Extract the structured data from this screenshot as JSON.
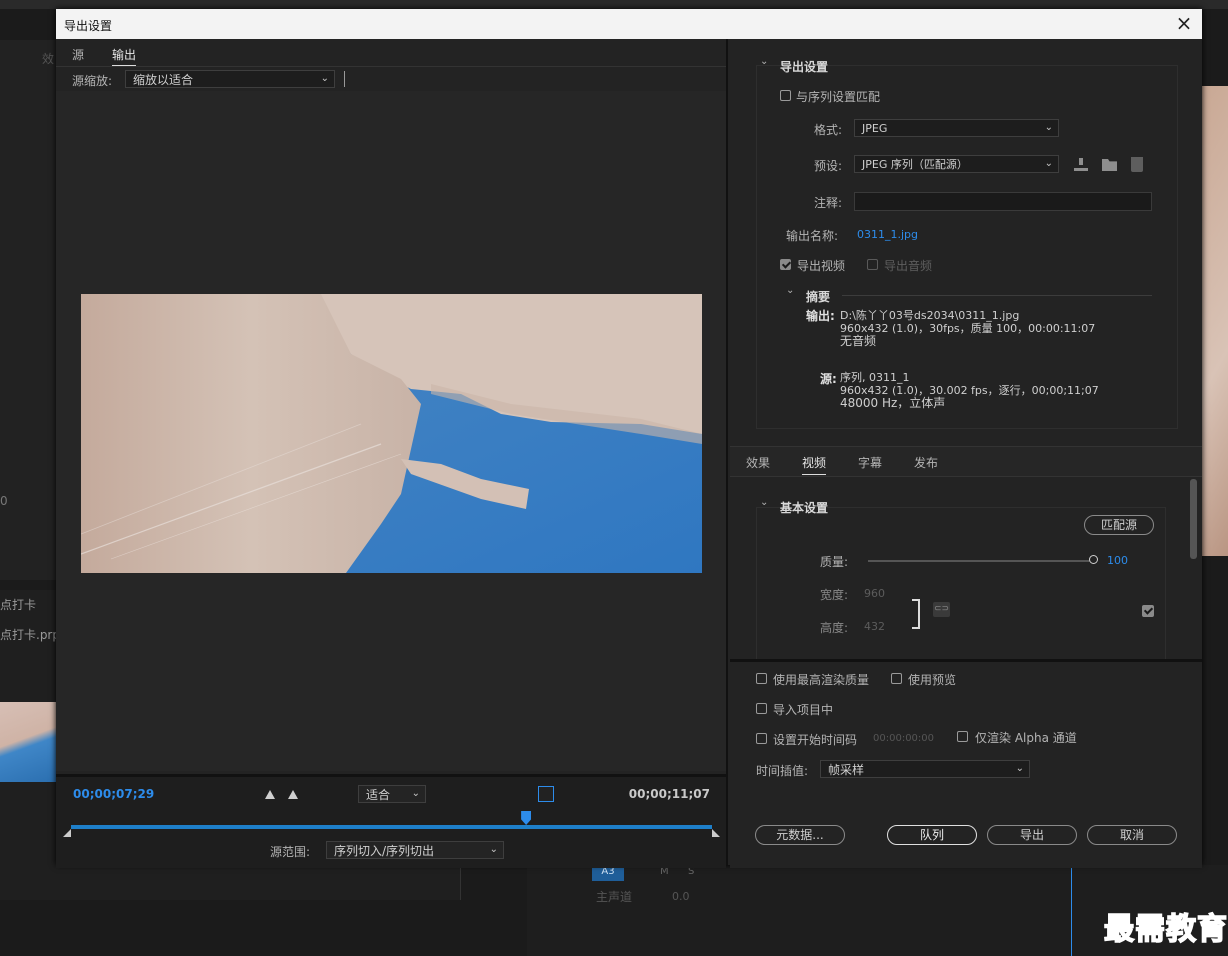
{
  "dialog": {
    "title": "导出设置",
    "close_label": "×"
  },
  "left": {
    "tabs": [
      {
        "label": "源"
      },
      {
        "label": "输出"
      }
    ],
    "scale_label": "源缩放:",
    "scale_value": "缩放以适合",
    "timecode_current": "00;00;07;29",
    "timecode_end": "00;00;11;07",
    "zoom_value": "适合",
    "source_range_label": "源范围:",
    "source_range_value": "序列切入/序列切出",
    "playhead_fraction": 0.71
  },
  "export": {
    "section_title": "导出设置",
    "match_sequence": "与序列设置匹配",
    "format_label": "格式:",
    "format_value": "JPEG",
    "preset_label": "预设:",
    "preset_value": "JPEG 序列（匹配源）",
    "comment_label": "注释:",
    "output_name_label": "输出名称:",
    "output_name_value": "0311_1.jpg",
    "export_video": "导出视频",
    "export_audio": "导出音频",
    "summary": {
      "title": "摘要",
      "output_key": "输出:",
      "output_line1": "D:\\陈丫丫03号ds2034\\0311_1.jpg",
      "output_line2": "960x432 (1.0)，30fps，质量 100，00:00:11:07",
      "output_line3": "无音频",
      "source_key": "源:",
      "source_line1": "序列, 0311_1",
      "source_line2": "960x432 (1.0)，30.002 fps，逐行，00;00;11;07",
      "source_line3": "48000 Hz，立体声"
    }
  },
  "tabs2": [
    {
      "label": "效果"
    },
    {
      "label": "视频"
    },
    {
      "label": "字幕"
    },
    {
      "label": "发布"
    }
  ],
  "basic": {
    "title": "基本设置",
    "match_source": "匹配源",
    "quality_label": "质量:",
    "quality_value": "100",
    "width_label": "宽度:",
    "width_value": "960",
    "height_label": "高度:",
    "height_value": "432"
  },
  "bottom": {
    "max_render": "使用最高渲染质量",
    "use_preview": "使用预览",
    "import_project": "导入项目中",
    "set_start_tc": "设置开始时间码",
    "start_tc_value": "00:00:00:00",
    "alpha_only": "仅渲染 Alpha 通道",
    "interp_label": "时间插值:",
    "interp_value": "帧采样",
    "metadata_btn": "元数据...",
    "queue_btn": "队列",
    "export_btn": "导出",
    "cancel_btn": "取消"
  },
  "background": {
    "left_tab": "效",
    "project_tab": "点打卡",
    "project_file": "点打卡.prpr",
    "zero": "0",
    "track_a3": "A3",
    "track_m": "M",
    "track_s": "S",
    "master": "主声道",
    "master_val": "0.0"
  },
  "watermark": "最需教育",
  "colors": {
    "accent": "#2d8ceb",
    "timeline": "#1e7fc9",
    "panel": "#232323"
  }
}
